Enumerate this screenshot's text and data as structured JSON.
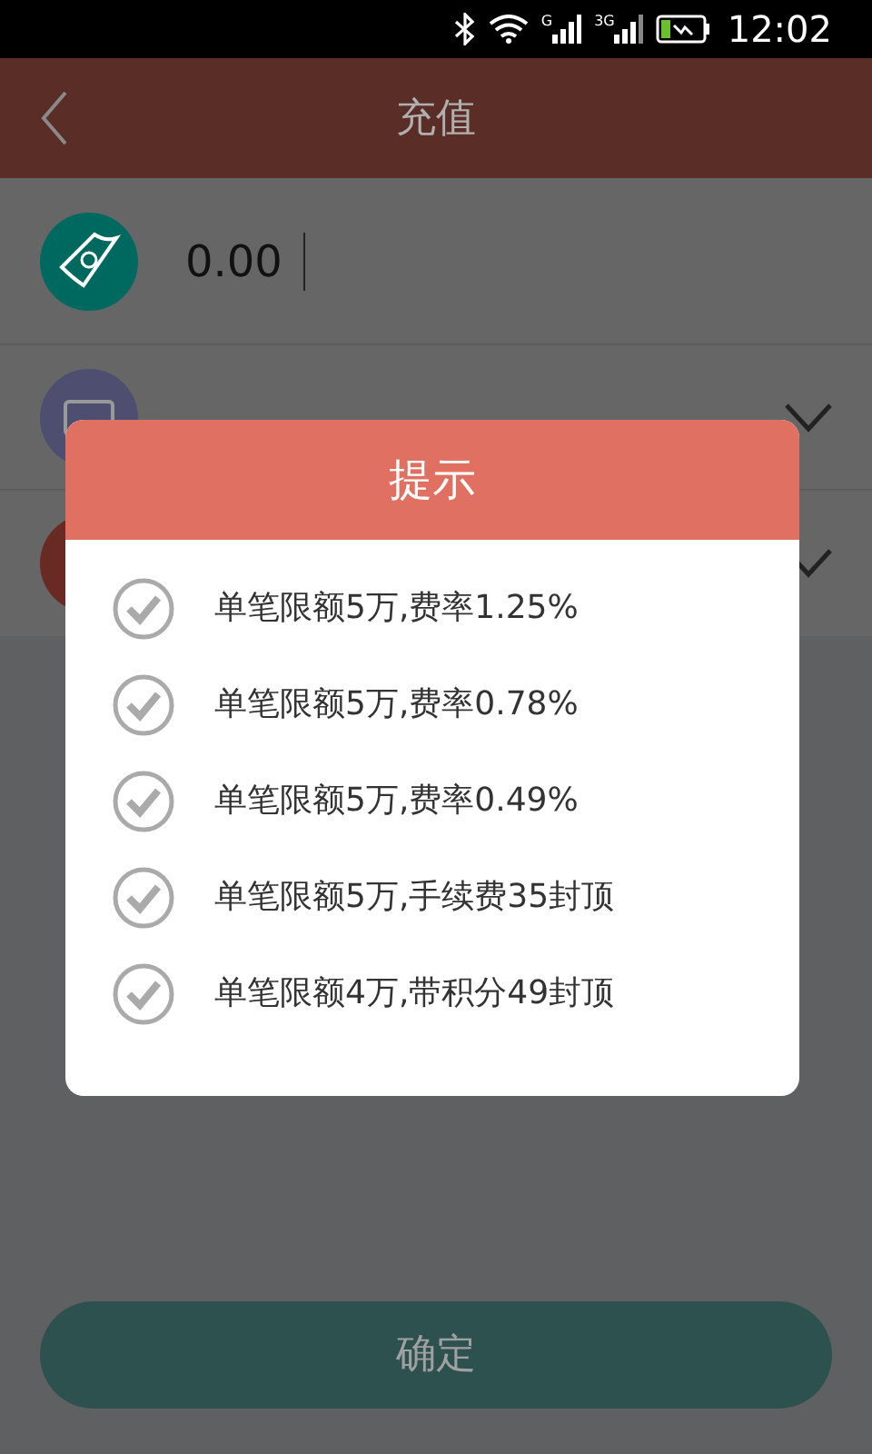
{
  "status_bar": {
    "signal_1_label": "G",
    "signal_2_label": "3G",
    "time": "12:02"
  },
  "header": {
    "title": "充值"
  },
  "form": {
    "amount": {
      "value": "0.00"
    }
  },
  "dialog": {
    "title": "提示",
    "options": [
      {
        "label": "单笔限额5万,费率1.25%",
        "selected": false
      },
      {
        "label": "单笔限额5万,费率0.78%",
        "selected": false
      },
      {
        "label": "单笔限额5万,费率0.49%",
        "selected": false
      },
      {
        "label": "单笔限额5万,手续费35封顶",
        "selected": false
      },
      {
        "label": "单笔限额4万,带积分49封顶",
        "selected": false
      }
    ]
  },
  "confirm_button": {
    "label": "确定"
  }
}
